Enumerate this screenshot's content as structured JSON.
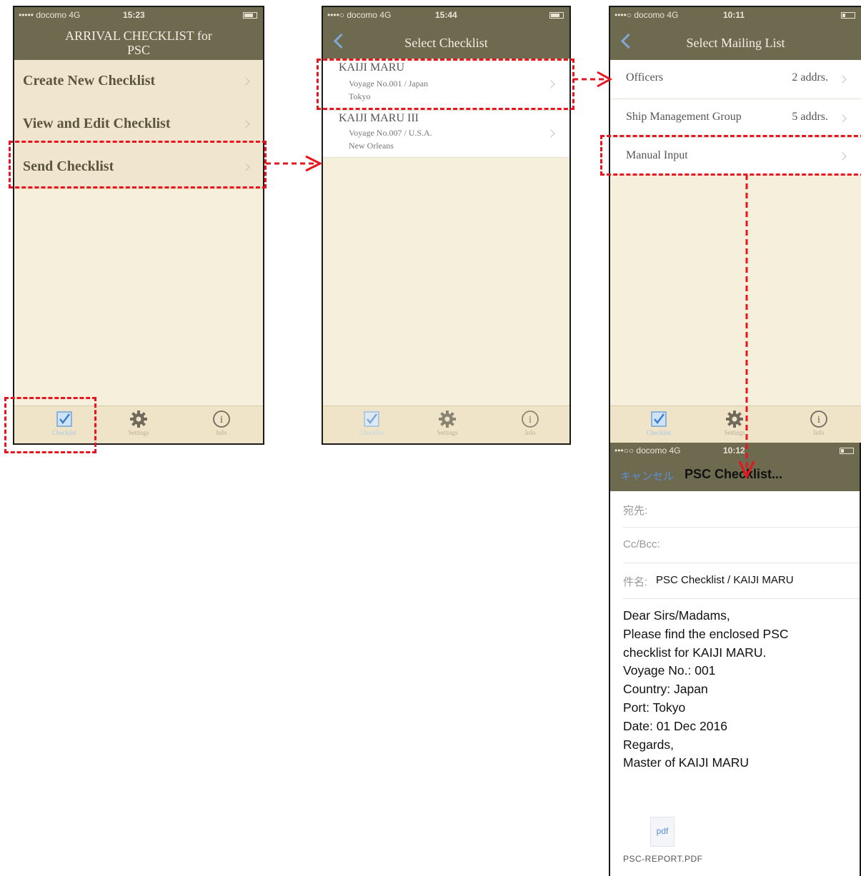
{
  "screen1": {
    "status": {
      "carrier": "••••• docomo  4G",
      "time": "15:23"
    },
    "title": "ARRIVAL CHECKLIST for PSC",
    "menu": [
      "Create New Checklist",
      "View and Edit Checklist",
      "Send Checklist"
    ],
    "tabs": [
      "Checklist",
      "Settings",
      "Info"
    ]
  },
  "screen2": {
    "status": {
      "carrier": "••••○ docomo  4G",
      "time": "15:44"
    },
    "title": "Select Checklist",
    "checklists": [
      {
        "name": "KAIJI MARU",
        "detail": "Voyage No.001 / Japan",
        "port": "Tokyo"
      },
      {
        "name": "KAIJI MARU III",
        "detail": "Voyage No.007 / U.S.A.",
        "port": "New Orleans"
      }
    ],
    "tabs": [
      "Checklist",
      "Settings",
      "Info"
    ]
  },
  "screen3": {
    "status": {
      "carrier": "••••○ docomo  4G",
      "time": "10:11"
    },
    "title": "Select Mailing List",
    "lists": [
      {
        "name": "Officers",
        "count": "2 addrs."
      },
      {
        "name": "Ship Management Group",
        "count": "5 addrs."
      },
      {
        "name": "Manual Input",
        "count": ""
      }
    ],
    "tabs": [
      "Checklist",
      "Settings",
      "Info"
    ]
  },
  "screen4": {
    "status": {
      "carrier": "•••○○ docomo  4G",
      "time": "10:12"
    },
    "cancel": "キャンセル",
    "title": "PSC Checklist...",
    "to_label": "宛先:",
    "ccbcc_label": "Cc/Bcc:",
    "subject_label": "件名:",
    "subject": "PSC Checklist / KAIJI MARU",
    "body": [
      "Dear Sirs/Madams,",
      "Please find the enclosed PSC",
      "checklist for KAIJI MARU.",
      "Voyage No.: 001",
      "Country: Japan",
      "Port: Tokyo",
      "Date: 01 Dec 2016",
      "Regards,",
      "Master of KAIJI MARU"
    ],
    "attachment_icon": "pdf",
    "attachment_name": "PSC-REPORT.PDF"
  },
  "colors": {
    "navbar": "#6e6a4f",
    "highlight": "#e8141e",
    "accent": "#7fa8d8"
  }
}
